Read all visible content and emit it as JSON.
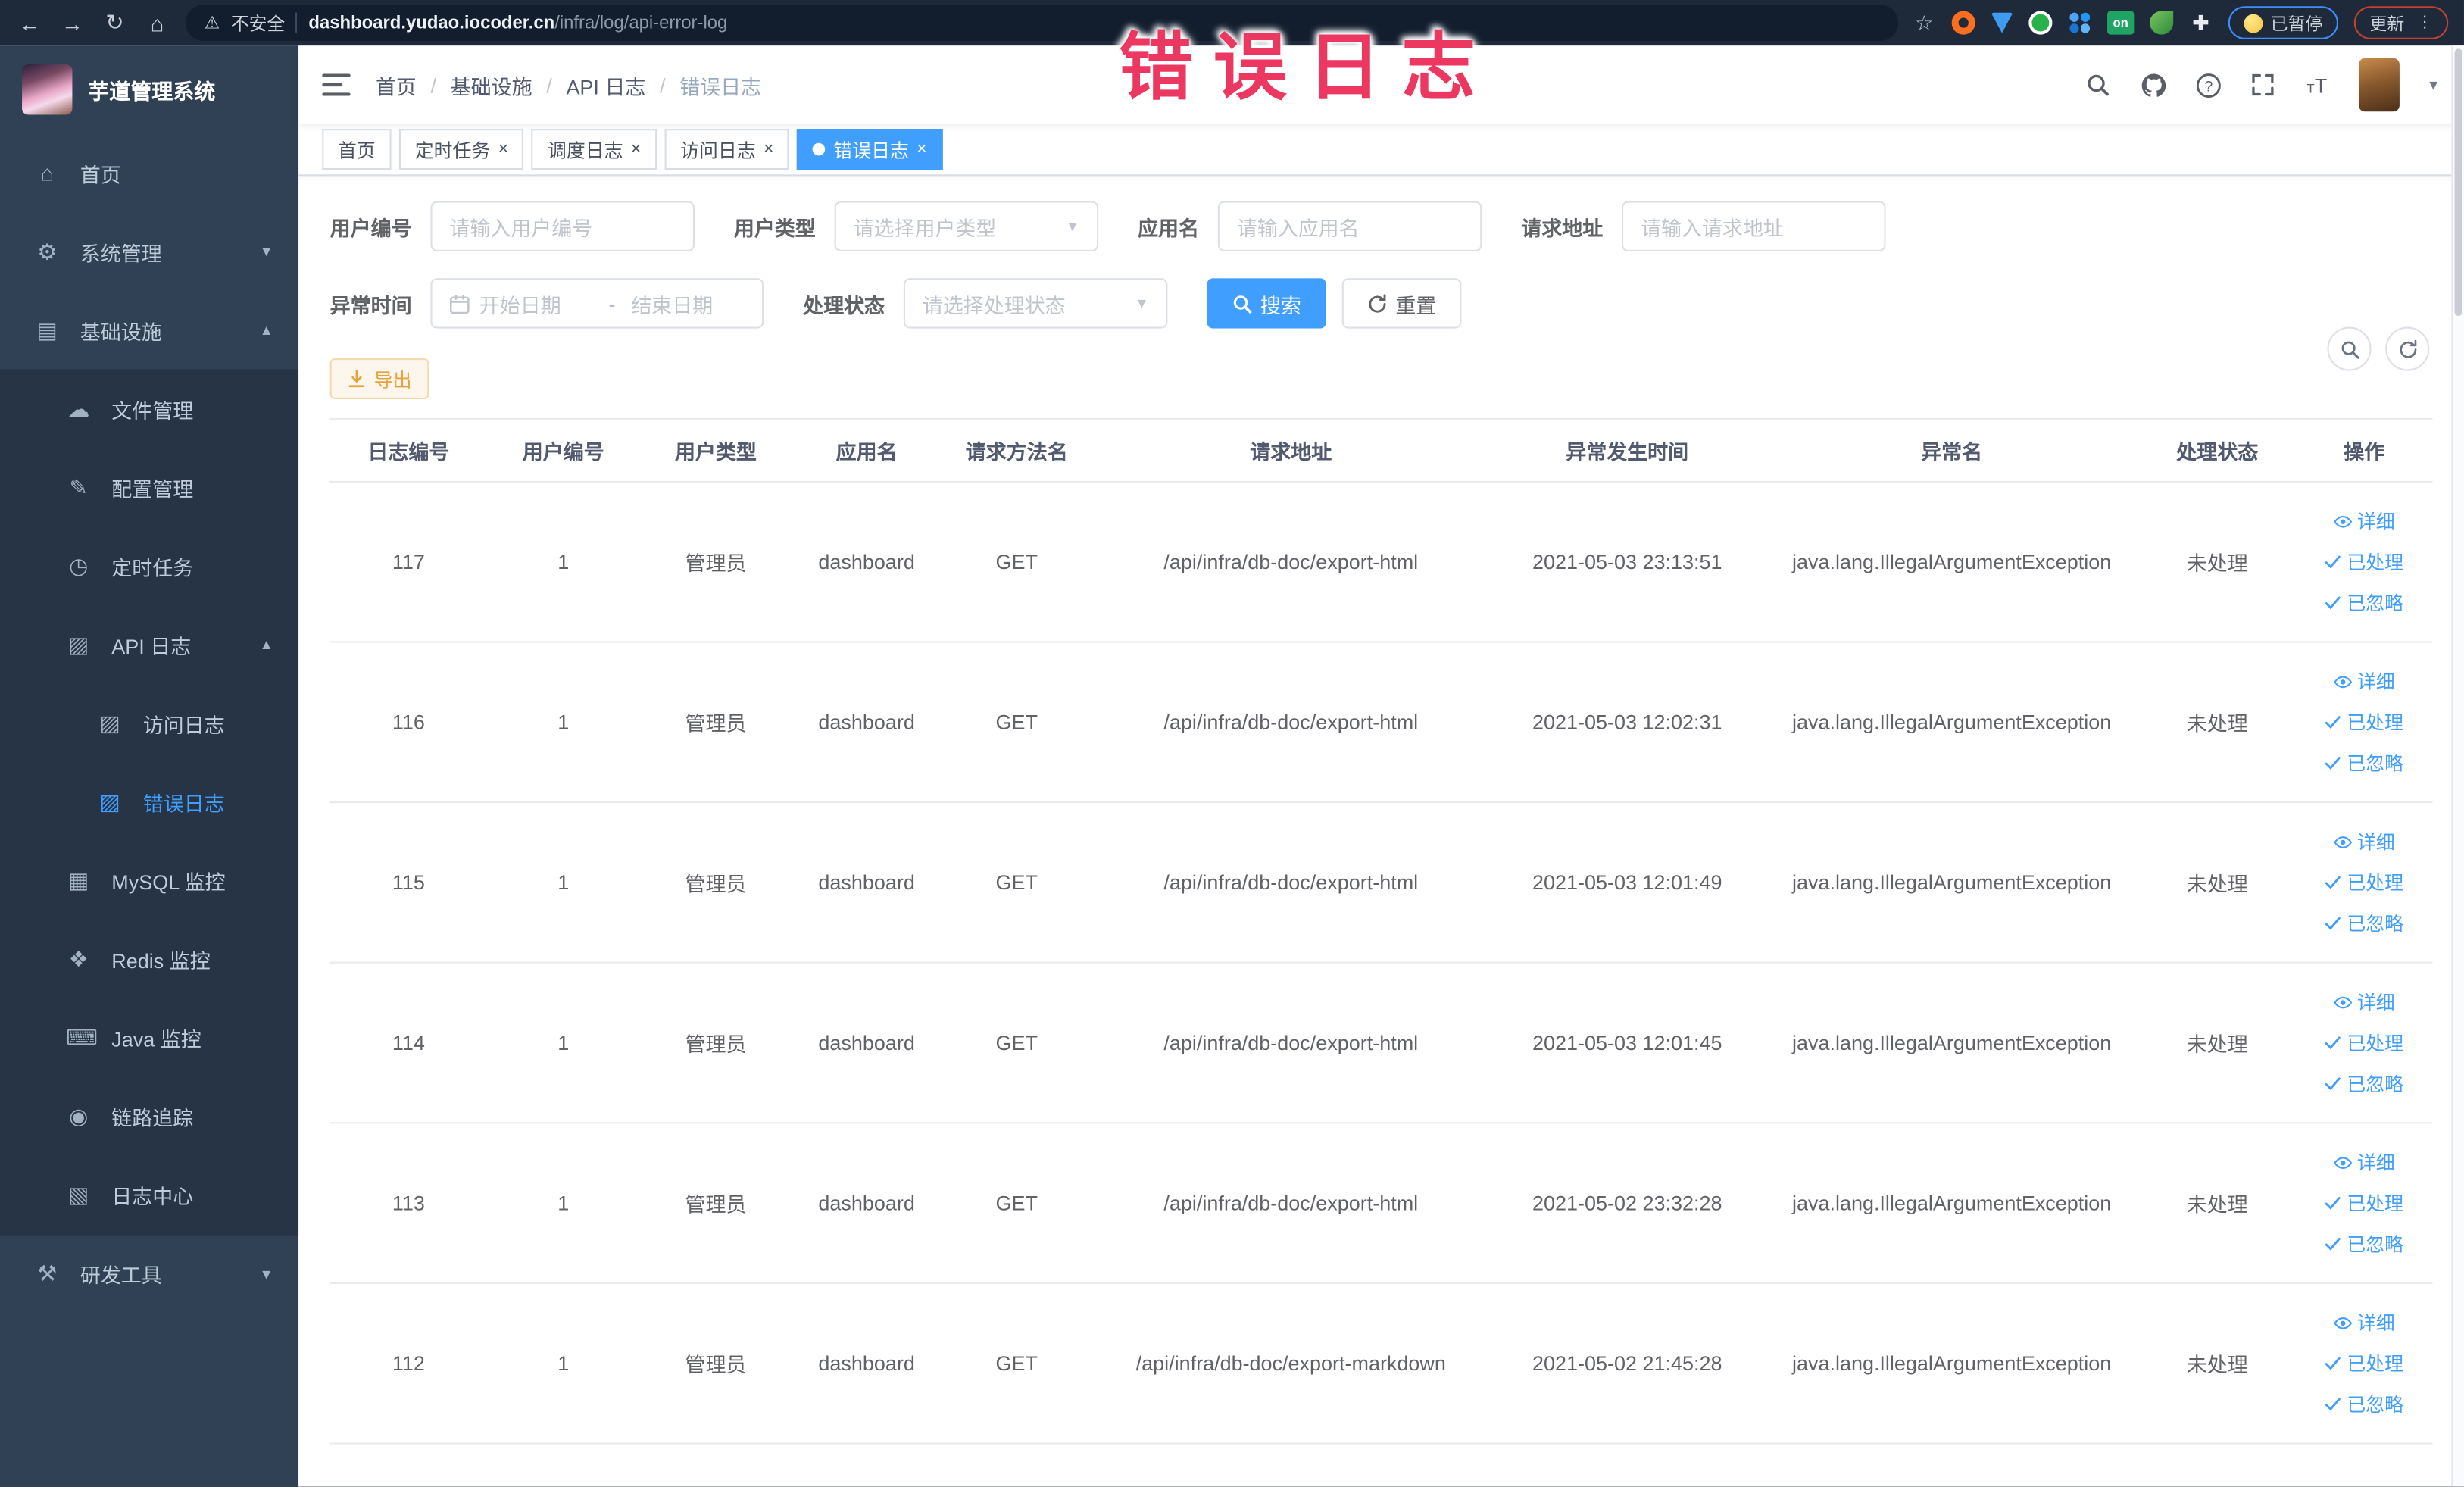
{
  "browser": {
    "back_icon": "←",
    "forward_icon": "→",
    "reload_icon": "↻",
    "home_icon": "⌂",
    "warning_icon": "⚠",
    "security_label": "不安全",
    "url_domain": "dashboard.yudao.iocoder.cn",
    "url_path": "/infra/log/api-error-log",
    "bookmark_star_icon": "☆",
    "extensions_puzzle_icon": "✚",
    "on_badge": "on",
    "paused_badge": "已暂停",
    "update_button": "更新",
    "menu_dots": "⋮"
  },
  "overlay_title": "错误日志",
  "sidebar": {
    "logo_title": "芋道管理系统",
    "items": [
      {
        "icon": "home-icon",
        "glyph": "⌂",
        "label": "首页",
        "level": 1
      },
      {
        "icon": "gear-icon",
        "glyph": "⚙",
        "label": "系统管理",
        "level": 1,
        "chevron": "down"
      },
      {
        "icon": "monitor-icon",
        "glyph": "▤",
        "label": "基础设施",
        "level": 1,
        "chevron": "up"
      },
      {
        "icon": "cloud-icon",
        "glyph": "☁",
        "label": "文件管理",
        "level": 2
      },
      {
        "icon": "edit-icon",
        "glyph": "✎",
        "label": "配置管理",
        "level": 2
      },
      {
        "icon": "timer-icon",
        "glyph": "◷",
        "label": "定时任务",
        "level": 2
      },
      {
        "icon": "api-log-icon",
        "glyph": "▨",
        "label": "API 日志",
        "level": 2,
        "chevron": "up"
      },
      {
        "icon": "access-log-icon",
        "glyph": "▨",
        "label": "访问日志",
        "level": 3
      },
      {
        "icon": "error-log-icon",
        "glyph": "▨",
        "label": "错误日志",
        "level": 3,
        "active": true
      },
      {
        "icon": "mysql-icon",
        "glyph": "▦",
        "label": "MySQL 监控",
        "level": 2
      },
      {
        "icon": "redis-icon",
        "glyph": "❖",
        "label": "Redis 监控",
        "level": 2
      },
      {
        "icon": "java-icon",
        "glyph": "⌨",
        "label": "Java 监控",
        "level": 2
      },
      {
        "icon": "trace-eye-icon",
        "glyph": "◉",
        "label": "链路追踪",
        "level": 2
      },
      {
        "icon": "log-center-icon",
        "glyph": "▧",
        "label": "日志中心",
        "level": 2
      },
      {
        "icon": "tools-icon",
        "glyph": "⚒",
        "label": "研发工具",
        "level": 1,
        "chevron": "down",
        "section": true
      }
    ]
  },
  "navbar": {
    "breadcrumb": [
      "首页",
      "基础设施",
      "API 日志",
      "错误日志"
    ],
    "separator": "/"
  },
  "tabs": [
    {
      "label": "首页",
      "closable": false,
      "active": false
    },
    {
      "label": "定时任务",
      "closable": true,
      "active": false
    },
    {
      "label": "调度日志",
      "closable": true,
      "active": false
    },
    {
      "label": "访问日志",
      "closable": true,
      "active": false
    },
    {
      "label": "错误日志",
      "closable": true,
      "active": true
    }
  ],
  "filters": {
    "user_id": {
      "label": "用户编号",
      "placeholder": "请输入用户编号"
    },
    "user_type": {
      "label": "用户类型",
      "placeholder": "请选择用户类型"
    },
    "app_name": {
      "label": "应用名",
      "placeholder": "请输入应用名"
    },
    "req_url": {
      "label": "请求地址",
      "placeholder": "请输入请求地址"
    },
    "time_range": {
      "label": "异常时间",
      "start_placeholder": "开始日期",
      "separator": "-",
      "end_placeholder": "结束日期"
    },
    "status": {
      "label": "处理状态",
      "placeholder": "请选择处理状态"
    },
    "search_label": "搜索",
    "reset_label": "重置"
  },
  "toolbar": {
    "export_label": "导出"
  },
  "table": {
    "columns": [
      "日志编号",
      "用户编号",
      "用户类型",
      "应用名",
      "请求方法名",
      "请求地址",
      "异常发生时间",
      "异常名",
      "处理状态",
      "操作"
    ],
    "row_actions": [
      "详细",
      "已处理",
      "已忽略"
    ],
    "rows": [
      {
        "id": "117",
        "user_id": "1",
        "user_type": "管理员",
        "app_name": "dashboard",
        "method": "GET",
        "url": "/api/infra/db-doc/export-html",
        "time": "2021-05-03 23:13:51",
        "exception": "java.lang.IllegalArgumentException",
        "status": "未处理"
      },
      {
        "id": "116",
        "user_id": "1",
        "user_type": "管理员",
        "app_name": "dashboard",
        "method": "GET",
        "url": "/api/infra/db-doc/export-html",
        "time": "2021-05-03 12:02:31",
        "exception": "java.lang.IllegalArgumentException",
        "status": "未处理"
      },
      {
        "id": "115",
        "user_id": "1",
        "user_type": "管理员",
        "app_name": "dashboard",
        "method": "GET",
        "url": "/api/infra/db-doc/export-html",
        "time": "2021-05-03 12:01:49",
        "exception": "java.lang.IllegalArgumentException",
        "status": "未处理"
      },
      {
        "id": "114",
        "user_id": "1",
        "user_type": "管理员",
        "app_name": "dashboard",
        "method": "GET",
        "url": "/api/infra/db-doc/export-html",
        "time": "2021-05-03 12:01:45",
        "exception": "java.lang.IllegalArgumentException",
        "status": "未处理"
      },
      {
        "id": "113",
        "user_id": "1",
        "user_type": "管理员",
        "app_name": "dashboard",
        "method": "GET",
        "url": "/api/infra/db-doc/export-html",
        "time": "2021-05-02 23:32:28",
        "exception": "java.lang.IllegalArgumentException",
        "status": "未处理"
      },
      {
        "id": "112",
        "user_id": "1",
        "user_type": "管理员",
        "app_name": "dashboard",
        "method": "GET",
        "url": "/api/infra/db-doc/export-markdown",
        "time": "2021-05-02 21:45:28",
        "exception": "java.lang.IllegalArgumentException",
        "status": "未处理"
      }
    ]
  },
  "colors": {
    "accent": "#409eff",
    "sidebar_bg": "#304156",
    "submenu_bg": "#263445",
    "warning": "#e6a23c",
    "overlay_pink": "#ec3760",
    "chrome_bg": "#1e2a3a"
  }
}
